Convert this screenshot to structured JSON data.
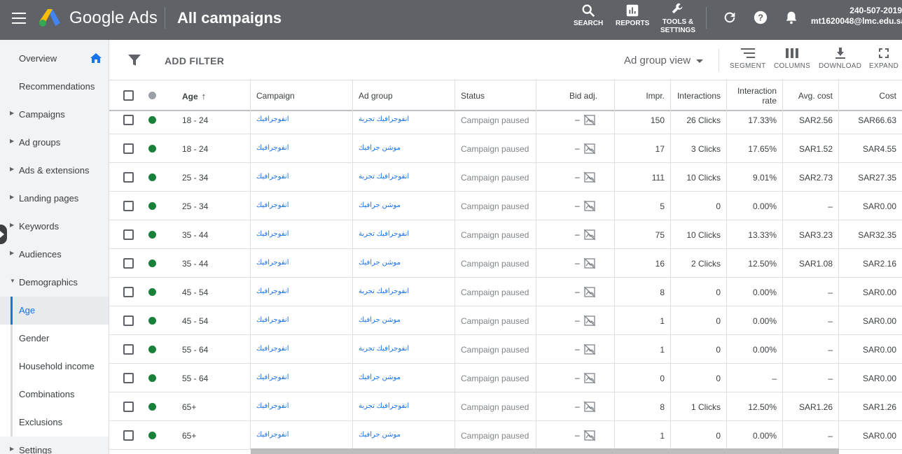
{
  "header": {
    "product_name": "Google Ads",
    "page_title": "All campaigns",
    "search_label": "SEARCH",
    "reports_label": "REPORTS",
    "tools_label_1": "TOOLS &",
    "tools_label_2": "SETTINGS",
    "account_id": "240-507-2019",
    "account_email": "mt1620048@lmc.edu.sa",
    "brand_colors": {
      "topbar": "#5f6368",
      "accent": "#1a73e8",
      "enabled": "#188038"
    }
  },
  "sidebar": {
    "items": [
      {
        "label": "Overview",
        "icon": "home-icon"
      },
      {
        "label": "Recommendations"
      },
      {
        "label": "Campaigns",
        "expandable": true
      },
      {
        "label": "Ad groups",
        "expandable": true
      },
      {
        "label": "Ads & extensions",
        "expandable": true
      },
      {
        "label": "Landing pages",
        "expandable": true
      },
      {
        "label": "Keywords",
        "expandable": true
      },
      {
        "label": "Audiences",
        "expandable": true
      },
      {
        "label": "Demographics",
        "expanded": true
      },
      {
        "label": "Age",
        "active": true
      },
      {
        "label": "Gender"
      },
      {
        "label": "Household income"
      },
      {
        "label": "Combinations"
      },
      {
        "label": "Exclusions"
      },
      {
        "label": "Settings",
        "expandable": true
      }
    ]
  },
  "toolbar": {
    "add_filter": "ADD FILTER",
    "view": "Ad group view",
    "segment": "SEGMENT",
    "columns": "COLUMNS",
    "download": "DOWNLOAD",
    "expand": "EXPAND"
  },
  "table": {
    "columns": {
      "age": "Age",
      "campaign": "Campaign",
      "ad_group": "Ad group",
      "status": "Status",
      "bid_adj": "Bid adj.",
      "impr": "Impr.",
      "interactions": "Interactions",
      "interaction_rate_1": "Interaction",
      "interaction_rate_2": "rate",
      "avg_cost": "Avg. cost",
      "cost": "Cost"
    },
    "rows": [
      {
        "age": "18 - 24",
        "campaign": "انفوجرافيك",
        "ad_group": "انفوجرافيك تجربة",
        "status": "Campaign paused",
        "bid": "–",
        "impr": "150",
        "interactions": "26 Clicks",
        "rate": "17.33%",
        "avg_cost": "SAR2.56",
        "cost": "SAR66.63"
      },
      {
        "age": "18 - 24",
        "campaign": "انفوجرافيك",
        "ad_group": "موشن جرافيك",
        "status": "Campaign paused",
        "bid": "–",
        "impr": "17",
        "interactions": "3 Clicks",
        "rate": "17.65%",
        "avg_cost": "SAR1.52",
        "cost": "SAR4.55"
      },
      {
        "age": "25 - 34",
        "campaign": "انفوجرافيك",
        "ad_group": "انفوجرافيك تجربة",
        "status": "Campaign paused",
        "bid": "–",
        "impr": "111",
        "interactions": "10 Clicks",
        "rate": "9.01%",
        "avg_cost": "SAR2.73",
        "cost": "SAR27.35"
      },
      {
        "age": "25 - 34",
        "campaign": "انفوجرافيك",
        "ad_group": "موشن جرافيك",
        "status": "Campaign paused",
        "bid": "–",
        "impr": "5",
        "interactions": "0",
        "rate": "0.00%",
        "avg_cost": "–",
        "cost": "SAR0.00"
      },
      {
        "age": "35 - 44",
        "campaign": "انفوجرافيك",
        "ad_group": "انفوجرافيك تجربة",
        "status": "Campaign paused",
        "bid": "–",
        "impr": "75",
        "interactions": "10 Clicks",
        "rate": "13.33%",
        "avg_cost": "SAR3.23",
        "cost": "SAR32.35"
      },
      {
        "age": "35 - 44",
        "campaign": "انفوجرافيك",
        "ad_group": "موشن جرافيك",
        "status": "Campaign paused",
        "bid": "–",
        "impr": "16",
        "interactions": "2 Clicks",
        "rate": "12.50%",
        "avg_cost": "SAR1.08",
        "cost": "SAR2.16"
      },
      {
        "age": "45 - 54",
        "campaign": "انفوجرافيك",
        "ad_group": "انفوجرافيك تجربة",
        "status": "Campaign paused",
        "bid": "–",
        "impr": "8",
        "interactions": "0",
        "rate": "0.00%",
        "avg_cost": "–",
        "cost": "SAR0.00"
      },
      {
        "age": "45 - 54",
        "campaign": "انفوجرافيك",
        "ad_group": "موشن جرافيك",
        "status": "Campaign paused",
        "bid": "–",
        "impr": "1",
        "interactions": "0",
        "rate": "0.00%",
        "avg_cost": "–",
        "cost": "SAR0.00"
      },
      {
        "age": "55 - 64",
        "campaign": "انفوجرافيك",
        "ad_group": "انفوجرافيك تجربة",
        "status": "Campaign paused",
        "bid": "–",
        "impr": "1",
        "interactions": "0",
        "rate": "0.00%",
        "avg_cost": "–",
        "cost": "SAR0.00"
      },
      {
        "age": "55 - 64",
        "campaign": "انفوجرافيك",
        "ad_group": "موشن جرافيك",
        "status": "Campaign paused",
        "bid": "–",
        "impr": "0",
        "interactions": "0",
        "rate": "–",
        "avg_cost": "–",
        "cost": "SAR0.00"
      },
      {
        "age": "65+",
        "campaign": "انفوجرافيك",
        "ad_group": "انفوجرافيك تجربة",
        "status": "Campaign paused",
        "bid": "–",
        "impr": "8",
        "interactions": "1 Clicks",
        "rate": "12.50%",
        "avg_cost": "SAR1.26",
        "cost": "SAR1.26"
      },
      {
        "age": "65+",
        "campaign": "انفوجرافيك",
        "ad_group": "موشن جرافيك",
        "status": "Campaign paused",
        "bid": "–",
        "impr": "1",
        "interactions": "0",
        "rate": "0.00%",
        "avg_cost": "–",
        "cost": "SAR0.00"
      }
    ]
  }
}
